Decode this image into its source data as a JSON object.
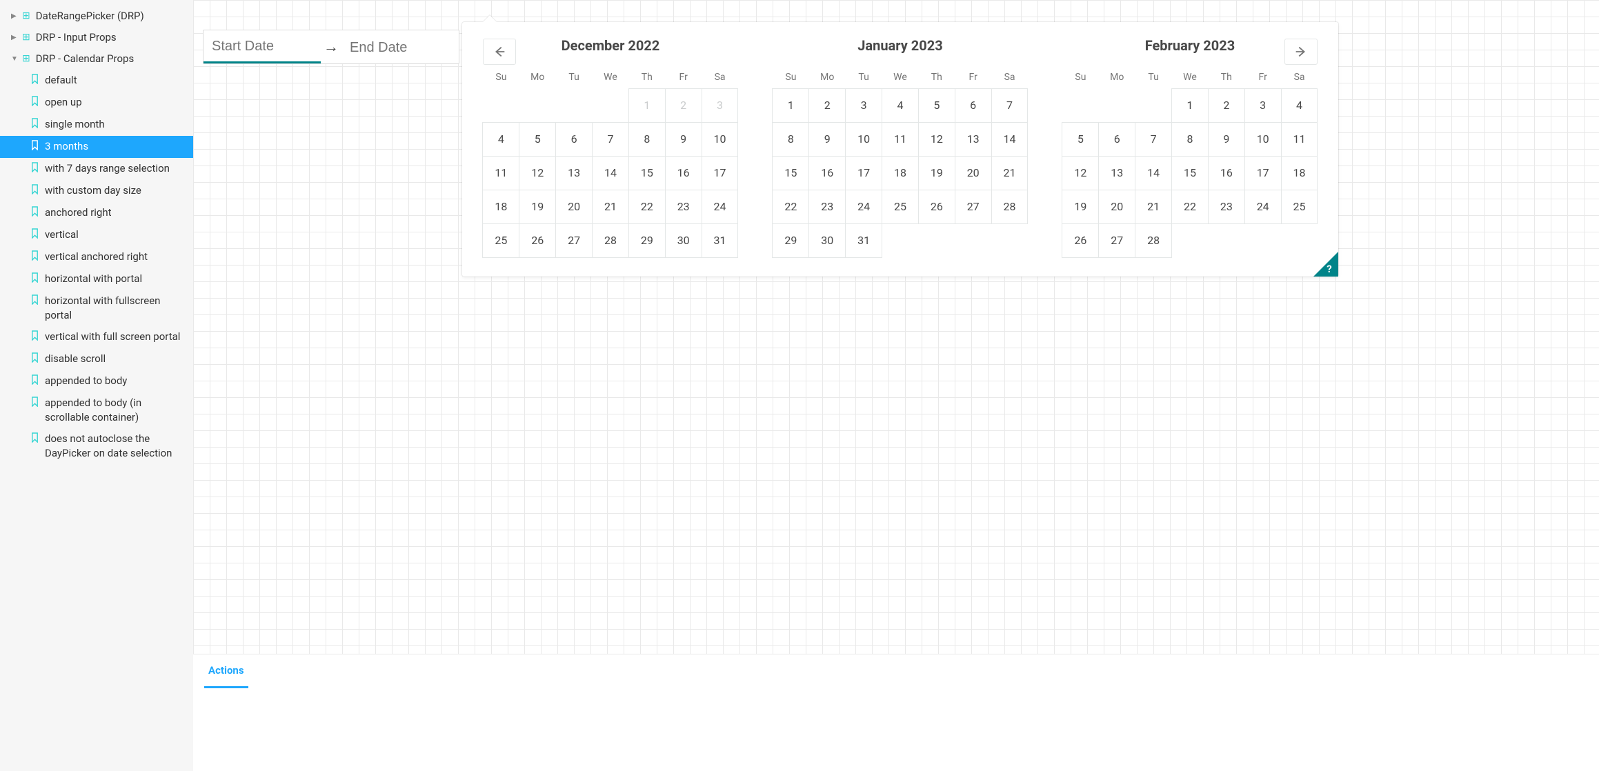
{
  "sidebar": {
    "groups": [
      {
        "label": "DateRangePicker (DRP)",
        "expanded": false
      },
      {
        "label": "DRP - Input Props",
        "expanded": false
      },
      {
        "label": "DRP - Calendar Props",
        "expanded": true
      }
    ],
    "items": [
      {
        "label": "default",
        "active": false
      },
      {
        "label": "open up",
        "active": false
      },
      {
        "label": "single month",
        "active": false
      },
      {
        "label": "3 months",
        "active": true
      },
      {
        "label": "with 7 days range selection",
        "active": false
      },
      {
        "label": "with custom day size",
        "active": false
      },
      {
        "label": "anchored right",
        "active": false
      },
      {
        "label": "vertical",
        "active": false
      },
      {
        "label": "vertical anchored right",
        "active": false
      },
      {
        "label": "horizontal with portal",
        "active": false
      },
      {
        "label": "horizontal with fullscreen portal",
        "active": false
      },
      {
        "label": "vertical with full screen portal",
        "active": false
      },
      {
        "label": "disable scroll",
        "active": false
      },
      {
        "label": "appended to body",
        "active": false
      },
      {
        "label": "appended to body (in scrollable container)",
        "active": false
      },
      {
        "label": "does not autoclose the DayPicker on date selection",
        "active": false
      }
    ]
  },
  "drp": {
    "start_placeholder": "Start Date",
    "end_placeholder": "End Date",
    "start_value": "",
    "end_value": "",
    "weekdays": [
      "Su",
      "Mo",
      "Tu",
      "We",
      "Th",
      "Fr",
      "Sa"
    ],
    "months": [
      {
        "title": "December 2022",
        "weeks": [
          [
            {
              "blank": true
            },
            {
              "blank": true
            },
            {
              "blank": true
            },
            {
              "blank": true
            },
            {
              "d": "1",
              "out": true
            },
            {
              "d": "2",
              "out": true
            },
            {
              "d": "3",
              "out": true
            }
          ],
          [
            {
              "d": "4"
            },
            {
              "d": "5"
            },
            {
              "d": "6"
            },
            {
              "d": "7"
            },
            {
              "d": "8"
            },
            {
              "d": "9"
            },
            {
              "d": "10"
            }
          ],
          [
            {
              "d": "11"
            },
            {
              "d": "12"
            },
            {
              "d": "13"
            },
            {
              "d": "14"
            },
            {
              "d": "15"
            },
            {
              "d": "16"
            },
            {
              "d": "17"
            }
          ],
          [
            {
              "d": "18"
            },
            {
              "d": "19"
            },
            {
              "d": "20"
            },
            {
              "d": "21"
            },
            {
              "d": "22"
            },
            {
              "d": "23"
            },
            {
              "d": "24"
            }
          ],
          [
            {
              "d": "25"
            },
            {
              "d": "26"
            },
            {
              "d": "27"
            },
            {
              "d": "28"
            },
            {
              "d": "29"
            },
            {
              "d": "30"
            },
            {
              "d": "31"
            }
          ]
        ]
      },
      {
        "title": "January 2023",
        "weeks": [
          [
            {
              "d": "1"
            },
            {
              "d": "2"
            },
            {
              "d": "3"
            },
            {
              "d": "4"
            },
            {
              "d": "5"
            },
            {
              "d": "6"
            },
            {
              "d": "7"
            }
          ],
          [
            {
              "d": "8"
            },
            {
              "d": "9"
            },
            {
              "d": "10"
            },
            {
              "d": "11"
            },
            {
              "d": "12"
            },
            {
              "d": "13"
            },
            {
              "d": "14"
            }
          ],
          [
            {
              "d": "15"
            },
            {
              "d": "16"
            },
            {
              "d": "17"
            },
            {
              "d": "18"
            },
            {
              "d": "19"
            },
            {
              "d": "20"
            },
            {
              "d": "21"
            }
          ],
          [
            {
              "d": "22"
            },
            {
              "d": "23"
            },
            {
              "d": "24"
            },
            {
              "d": "25"
            },
            {
              "d": "26"
            },
            {
              "d": "27"
            },
            {
              "d": "28"
            }
          ],
          [
            {
              "d": "29"
            },
            {
              "d": "30"
            },
            {
              "d": "31"
            },
            {
              "blank": true
            },
            {
              "blank": true
            },
            {
              "blank": true
            },
            {
              "blank": true
            }
          ]
        ]
      },
      {
        "title": "February 2023",
        "weeks": [
          [
            {
              "blank": true
            },
            {
              "blank": true
            },
            {
              "blank": true
            },
            {
              "d": "1"
            },
            {
              "d": "2"
            },
            {
              "d": "3"
            },
            {
              "d": "4"
            }
          ],
          [
            {
              "d": "5"
            },
            {
              "d": "6"
            },
            {
              "d": "7"
            },
            {
              "d": "8"
            },
            {
              "d": "9"
            },
            {
              "d": "10"
            },
            {
              "d": "11"
            }
          ],
          [
            {
              "d": "12"
            },
            {
              "d": "13"
            },
            {
              "d": "14"
            },
            {
              "d": "15"
            },
            {
              "d": "16"
            },
            {
              "d": "17"
            },
            {
              "d": "18"
            }
          ],
          [
            {
              "d": "19"
            },
            {
              "d": "20"
            },
            {
              "d": "21"
            },
            {
              "d": "22"
            },
            {
              "d": "23"
            },
            {
              "d": "24"
            },
            {
              "d": "25"
            }
          ],
          [
            {
              "d": "26"
            },
            {
              "d": "27"
            },
            {
              "d": "28"
            },
            {
              "blank": true
            },
            {
              "blank": true
            },
            {
              "blank": true
            },
            {
              "blank": true
            }
          ]
        ]
      }
    ],
    "help": "?"
  },
  "panel": {
    "tab": "Actions"
  }
}
